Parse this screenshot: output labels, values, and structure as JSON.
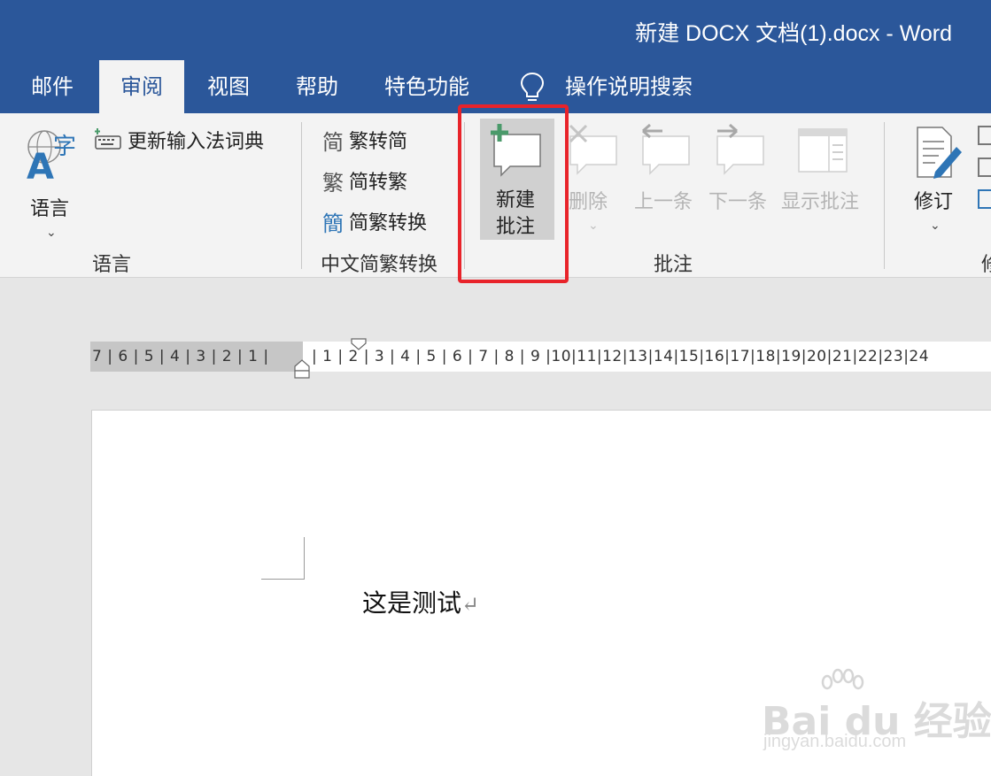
{
  "window": {
    "title": "新建 DOCX 文档(1).docx  -  Word"
  },
  "tabs": [
    {
      "label": "邮件"
    },
    {
      "label": "审阅",
      "active": true
    },
    {
      "label": "视图"
    },
    {
      "label": "帮助"
    },
    {
      "label": "特色功能"
    }
  ],
  "tell_me": {
    "label": "操作说明搜索",
    "icon": "lightbulb-icon"
  },
  "ribbon": {
    "language_group": {
      "language_button": "语言",
      "update_ime_dictionary": "更新输入法词典",
      "group_label": "语言"
    },
    "chinese_conversion_group": {
      "trad_to_simp": "繁转简",
      "simp_to_trad": "简转繁",
      "convert": "简繁转换",
      "group_label": "中文简繁转换",
      "icon_chars": [
        "简",
        "繁",
        "簡"
      ]
    },
    "comments_group": {
      "new_comment_line1": "新建",
      "new_comment_line2": "批注",
      "delete": "删除",
      "previous": "上一条",
      "next": "下一条",
      "show_comments": "显示批注",
      "group_label": "批注"
    },
    "tracking_group": {
      "track_changes": "修订",
      "group_label_partial": "修"
    }
  },
  "ruler": {
    "left_numbers": "7 | 6 | 5 | 4 | 3 | 2 | 1 |",
    "right_numbers": "| 1 | 2 | 3 | 4 | 5 | 6 | 7 | 8 | 9 |10|11|12|13|14|15|16|17|18|19|20|21|22|23|24"
  },
  "document": {
    "body_text": "这是测试",
    "paragraph_mark": "↵"
  },
  "watermark": {
    "main": "Bai du 经验",
    "sub": "jingyan.baidu.com"
  },
  "colors": {
    "title_bar": "#2b579a",
    "ribbon_bg": "#f3f3f3",
    "highlight_box": "#e8232a",
    "disabled_text": "#b4b4b4"
  }
}
